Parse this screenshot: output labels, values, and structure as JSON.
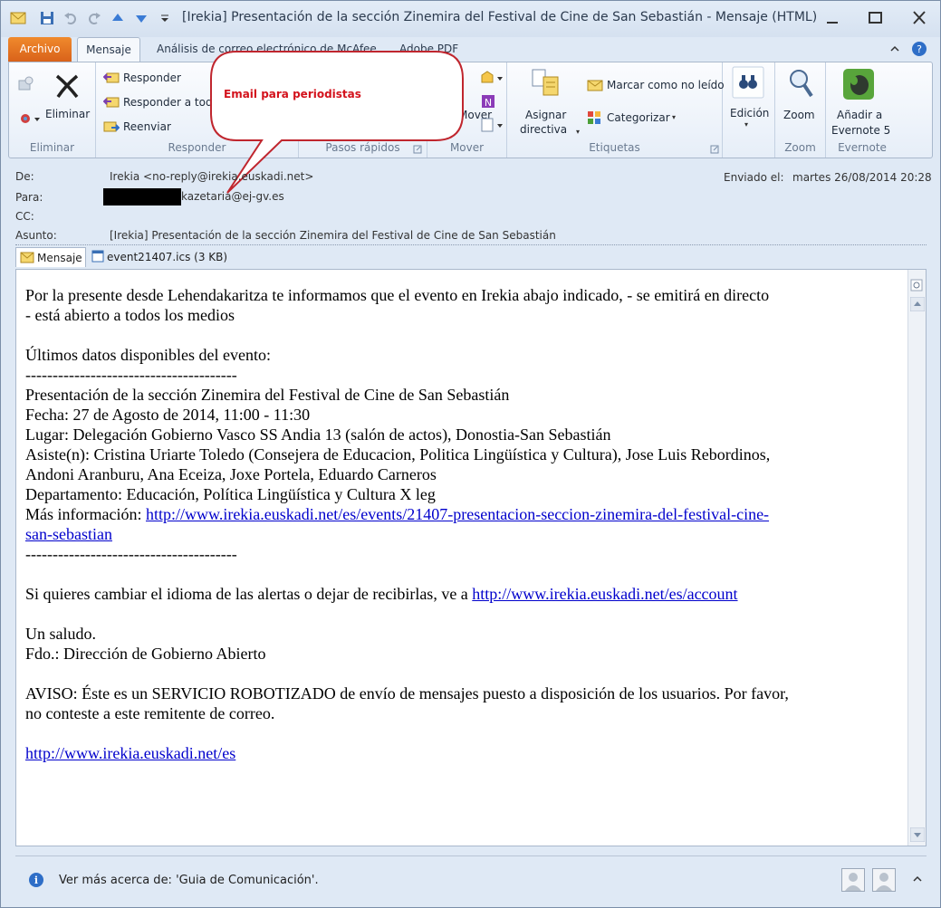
{
  "window": {
    "title": "[Irekia] Presentación de la sección Zinemira del Festival de Cine de San Sebastián  -  Mensaje (HTML)"
  },
  "tabs": [
    {
      "label": "Archivo"
    },
    {
      "label": "Mensaje"
    },
    {
      "label": "Análisis de correo electrónico de McAfee"
    },
    {
      "label": "Adobe PDF"
    }
  ],
  "ribbon": {
    "eliminar": {
      "delete_label": "Eliminar",
      "group_label": "Eliminar"
    },
    "responder": {
      "reply_label": "Responder",
      "reply_all_label": "Responder a todos",
      "forward_label": "Reenviar",
      "group_label": "Responder"
    },
    "pasos_rapidos": {
      "group_label": "Pasos rápidos"
    },
    "mover": {
      "move_label": "Mover",
      "group_label": "Mover"
    },
    "etiquetas": {
      "assign_label_1": "Asignar",
      "assign_label_2": "directiva",
      "mark_unread_label": "Marcar como no leído",
      "categorize_label": "Categorizar",
      "group_label": "Etiquetas"
    },
    "edicion": {
      "label": "Edición"
    },
    "zoom": {
      "button_label": "Zoom",
      "group_label": "Zoom"
    },
    "evernote": {
      "label_1": "Añadir a",
      "label_2": "Evernote 5",
      "group_label": "Evernote"
    }
  },
  "callout": {
    "text": "Email para periodistas"
  },
  "header": {
    "from_label": "De:",
    "from_value": "Irekia <no-reply@irekia.euskadi.net>",
    "to_label": "Para:",
    "to_value": "kazetaria@ej-gv.es",
    "cc_label": "CC:",
    "subject_label": "Asunto:",
    "subject_value": "[Irekia] Presentación de la sección Zinemira del Festival de Cine de San Sebastián",
    "sent_label": "Enviado el:",
    "sent_value": "martes 26/08/2014 20:28"
  },
  "attachments": [
    {
      "label": "Mensaje"
    },
    {
      "label": "event21407.ics (3 KB)"
    }
  ],
  "message": {
    "intro_1": "Por la presente desde Lehendakaritza te informamos que el evento en Irekia abajo indicado, - se emitirá en directo",
    "intro_2": "- está abierto a todos los medios",
    "latest_heading": "Últimos datos disponibles del evento:",
    "separator": "---------------------------------------",
    "event_title": "Presentación de la sección Zinemira del Festival de Cine de San Sebastián",
    "date_line": "Fecha: 27 de Agosto de 2014, 11:00 - 11:30",
    "place_line": "Lugar: Delegación Gobierno Vasco SS Andia 13 (salón de actos), Donostia-San Sebastián",
    "attendees_1": "Asiste(n): Cristina Uriarte Toledo (Consejera de Educacion, Politica Lingüística y Cultura), Jose Luis Rebordinos,",
    "attendees_2": "Andoni Aranburu, Ana Eceiza, Joxe Portela, Eduardo Carneros",
    "department_line": "Departamento: Educación, Política Lingüística y Cultura X leg",
    "more_info_label": "Más información: ",
    "more_info_link_1": "http://www.irekia.euskadi.net/es/events/21407-presentacion-seccion-zinemira-del-festival-cine-",
    "more_info_link_2": "san-sebastian",
    "change_lang_text": "Si quieres cambiar el idioma de las alertas o dejar de recibirlas, ve a ",
    "account_link": "http://www.irekia.euskadi.net/es/account",
    "greeting": "Un saludo.",
    "signature": "Fdo.: Dirección de Gobierno Abierto",
    "notice_1": "AVISO: Éste es un SERVICIO ROBOTIZADO de envío de mensajes puesto a disposición de los usuarios. Por favor,",
    "notice_2": "no conteste a este remitente de correo.",
    "home_link": "http://www.irekia.euskadi.net/es"
  },
  "infobar": {
    "text": "Ver más acerca de: 'Guia de Comunicación'."
  },
  "colors": {
    "accent": "#d9621a",
    "callout_border": "#c0262e",
    "callout_text": "#d3121c",
    "link": "#0000cc"
  }
}
